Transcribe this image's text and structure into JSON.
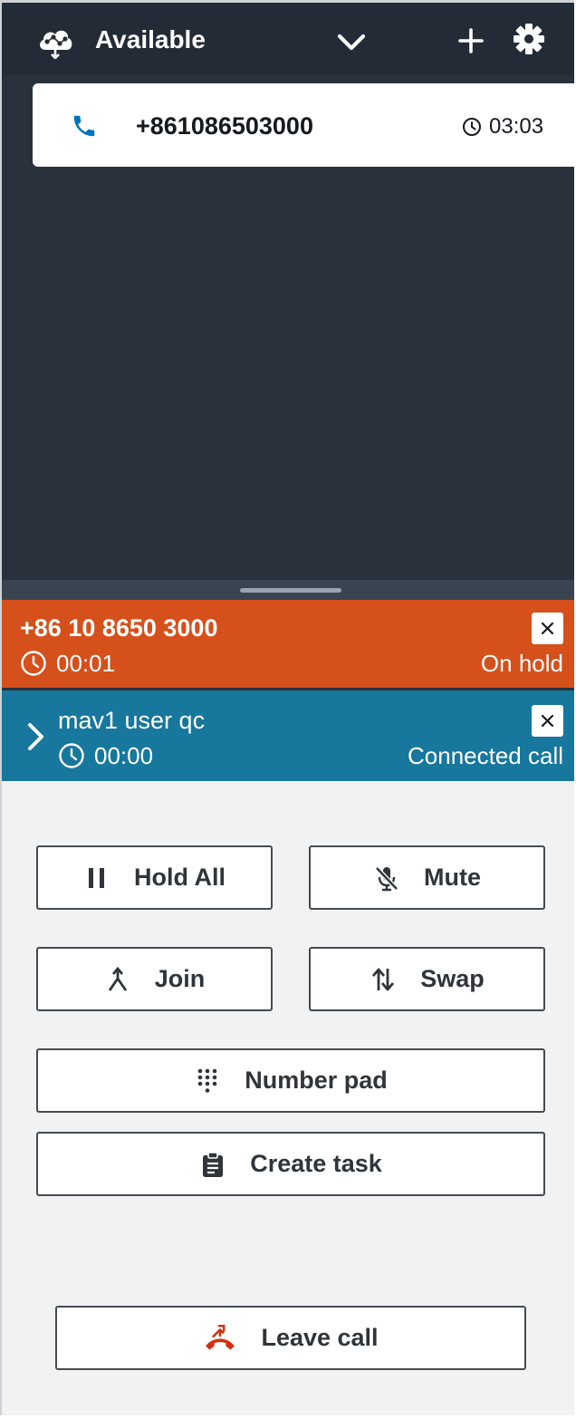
{
  "header": {
    "status_label": "Available",
    "icons": {
      "status": "cloud-network-icon",
      "dropdown": "chevron-down-icon",
      "add": "plus-icon",
      "settings": "gear-icon"
    }
  },
  "contact_card": {
    "phone_number": "+861086503000",
    "duration": "03:03",
    "icons": {
      "type": "phone-icon",
      "timer": "clock-icon"
    },
    "accent": "#0073bb"
  },
  "connections": [
    {
      "name": "+86 10 8650 3000",
      "timer": "00:01",
      "state": "On hold",
      "color": "#d5501b"
    },
    {
      "name": "mav1 user qc",
      "timer": "00:00",
      "state": "Connected call",
      "color": "#17779c"
    }
  ],
  "actions": {
    "hold_all": "Hold All",
    "mute": "Mute",
    "join": "Join",
    "swap": "Swap",
    "number_pad": "Number pad",
    "create_task": "Create task",
    "leave_call": "Leave call"
  },
  "colors": {
    "header_bg": "#232c36",
    "panel_bg": "#28313c",
    "actions_bg": "#f2f2f2",
    "leave_icon": "#d13212"
  }
}
